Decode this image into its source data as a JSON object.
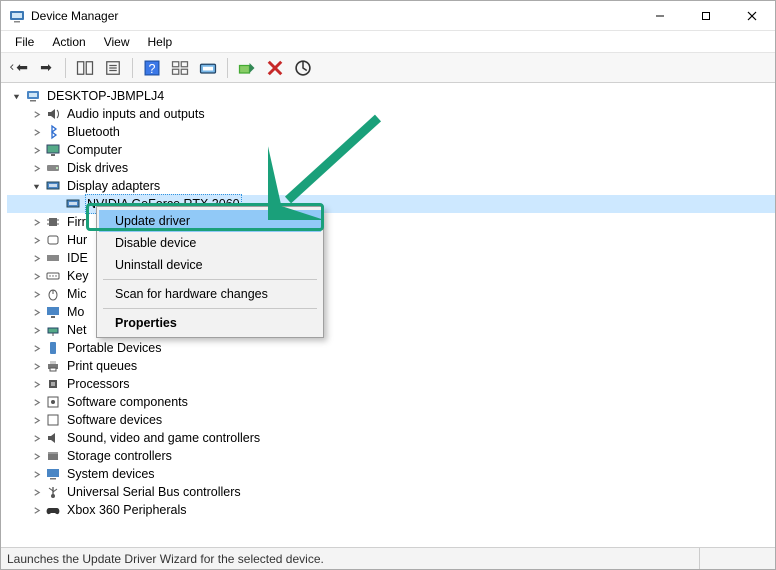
{
  "window": {
    "title": "Device Manager"
  },
  "menu": {
    "file": "File",
    "action": "Action",
    "view": "View",
    "help": "Help"
  },
  "tree": {
    "root": "DESKTOP-JBMPLJ4",
    "categories": {
      "audio": "Audio inputs and outputs",
      "bluetooth": "Bluetooth",
      "computer": "Computer",
      "disk": "Disk drives",
      "display": "Display adapters",
      "firmware": "Firmware",
      "hid": "Human Interface Devices",
      "ide": "IDE ATA/ATAPI controllers",
      "keyboards": "Keyboards",
      "mice": "Mice and other pointing devices",
      "monitors": "Monitors",
      "network": "Network adapters",
      "portable": "Portable Devices",
      "printq": "Print queues",
      "processors": "Processors",
      "swcomponents": "Software components",
      "swdevices": "Software devices",
      "sound": "Sound, video and game controllers",
      "storage": "Storage controllers",
      "system": "System devices",
      "usb": "Universal Serial Bus controllers",
      "xbox": "Xbox 360 Peripherals"
    },
    "display_children": {
      "nvidia": "NVIDIA GeForce RTX 2060"
    },
    "truncated": {
      "firmware": "Firr",
      "hid": "Hur",
      "ide": "IDE",
      "keyboards": "Key",
      "mice": "Mic",
      "monitors": "Mo",
      "network": "Net"
    }
  },
  "context_menu": {
    "update_driver": "Update driver",
    "disable_device": "Disable device",
    "uninstall_device": "Uninstall device",
    "scan": "Scan for hardware changes",
    "properties": "Properties"
  },
  "statusbar": {
    "text": "Launches the Update Driver Wizard for the selected device."
  }
}
